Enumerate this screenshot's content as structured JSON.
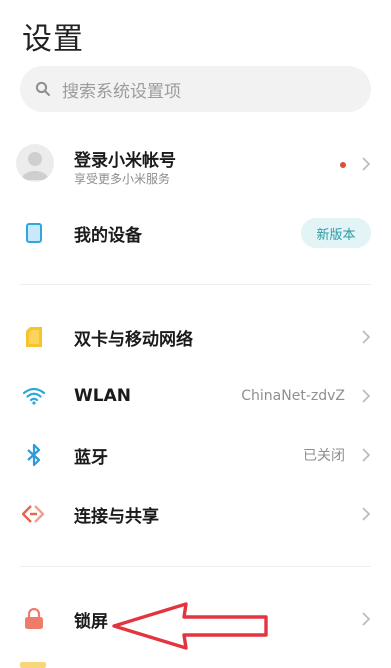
{
  "header": {
    "title": "设置"
  },
  "search": {
    "placeholder": "搜索系统设置项",
    "icon": "search-icon"
  },
  "account": {
    "name": "登录小米帐号",
    "subtitle": "享受更多小米服务",
    "notification_color": "#e24b36"
  },
  "device": {
    "label": "我的设备",
    "badge": "新版本"
  },
  "network": {
    "items": [
      {
        "label": "双卡与移动网络",
        "value": "",
        "icon": "sim-card-icon",
        "color": "#f5b923"
      },
      {
        "label": "WLAN",
        "value": "ChinaNet-zdvZ",
        "icon": "wifi-icon",
        "color": "#2fa8d8"
      },
      {
        "label": "蓝牙",
        "value": "已关闭",
        "icon": "bluetooth-icon",
        "color": "#2f9ad8"
      },
      {
        "label": "连接与共享",
        "value": "",
        "icon": "connection-share-icon",
        "color": "#e8644a"
      }
    ]
  },
  "personal": {
    "items": [
      {
        "label": "锁屏",
        "value": "",
        "icon": "lock-icon",
        "color": "#ee7c6b"
      }
    ]
  },
  "annotation": {
    "arrow_color": "#e3353f"
  }
}
